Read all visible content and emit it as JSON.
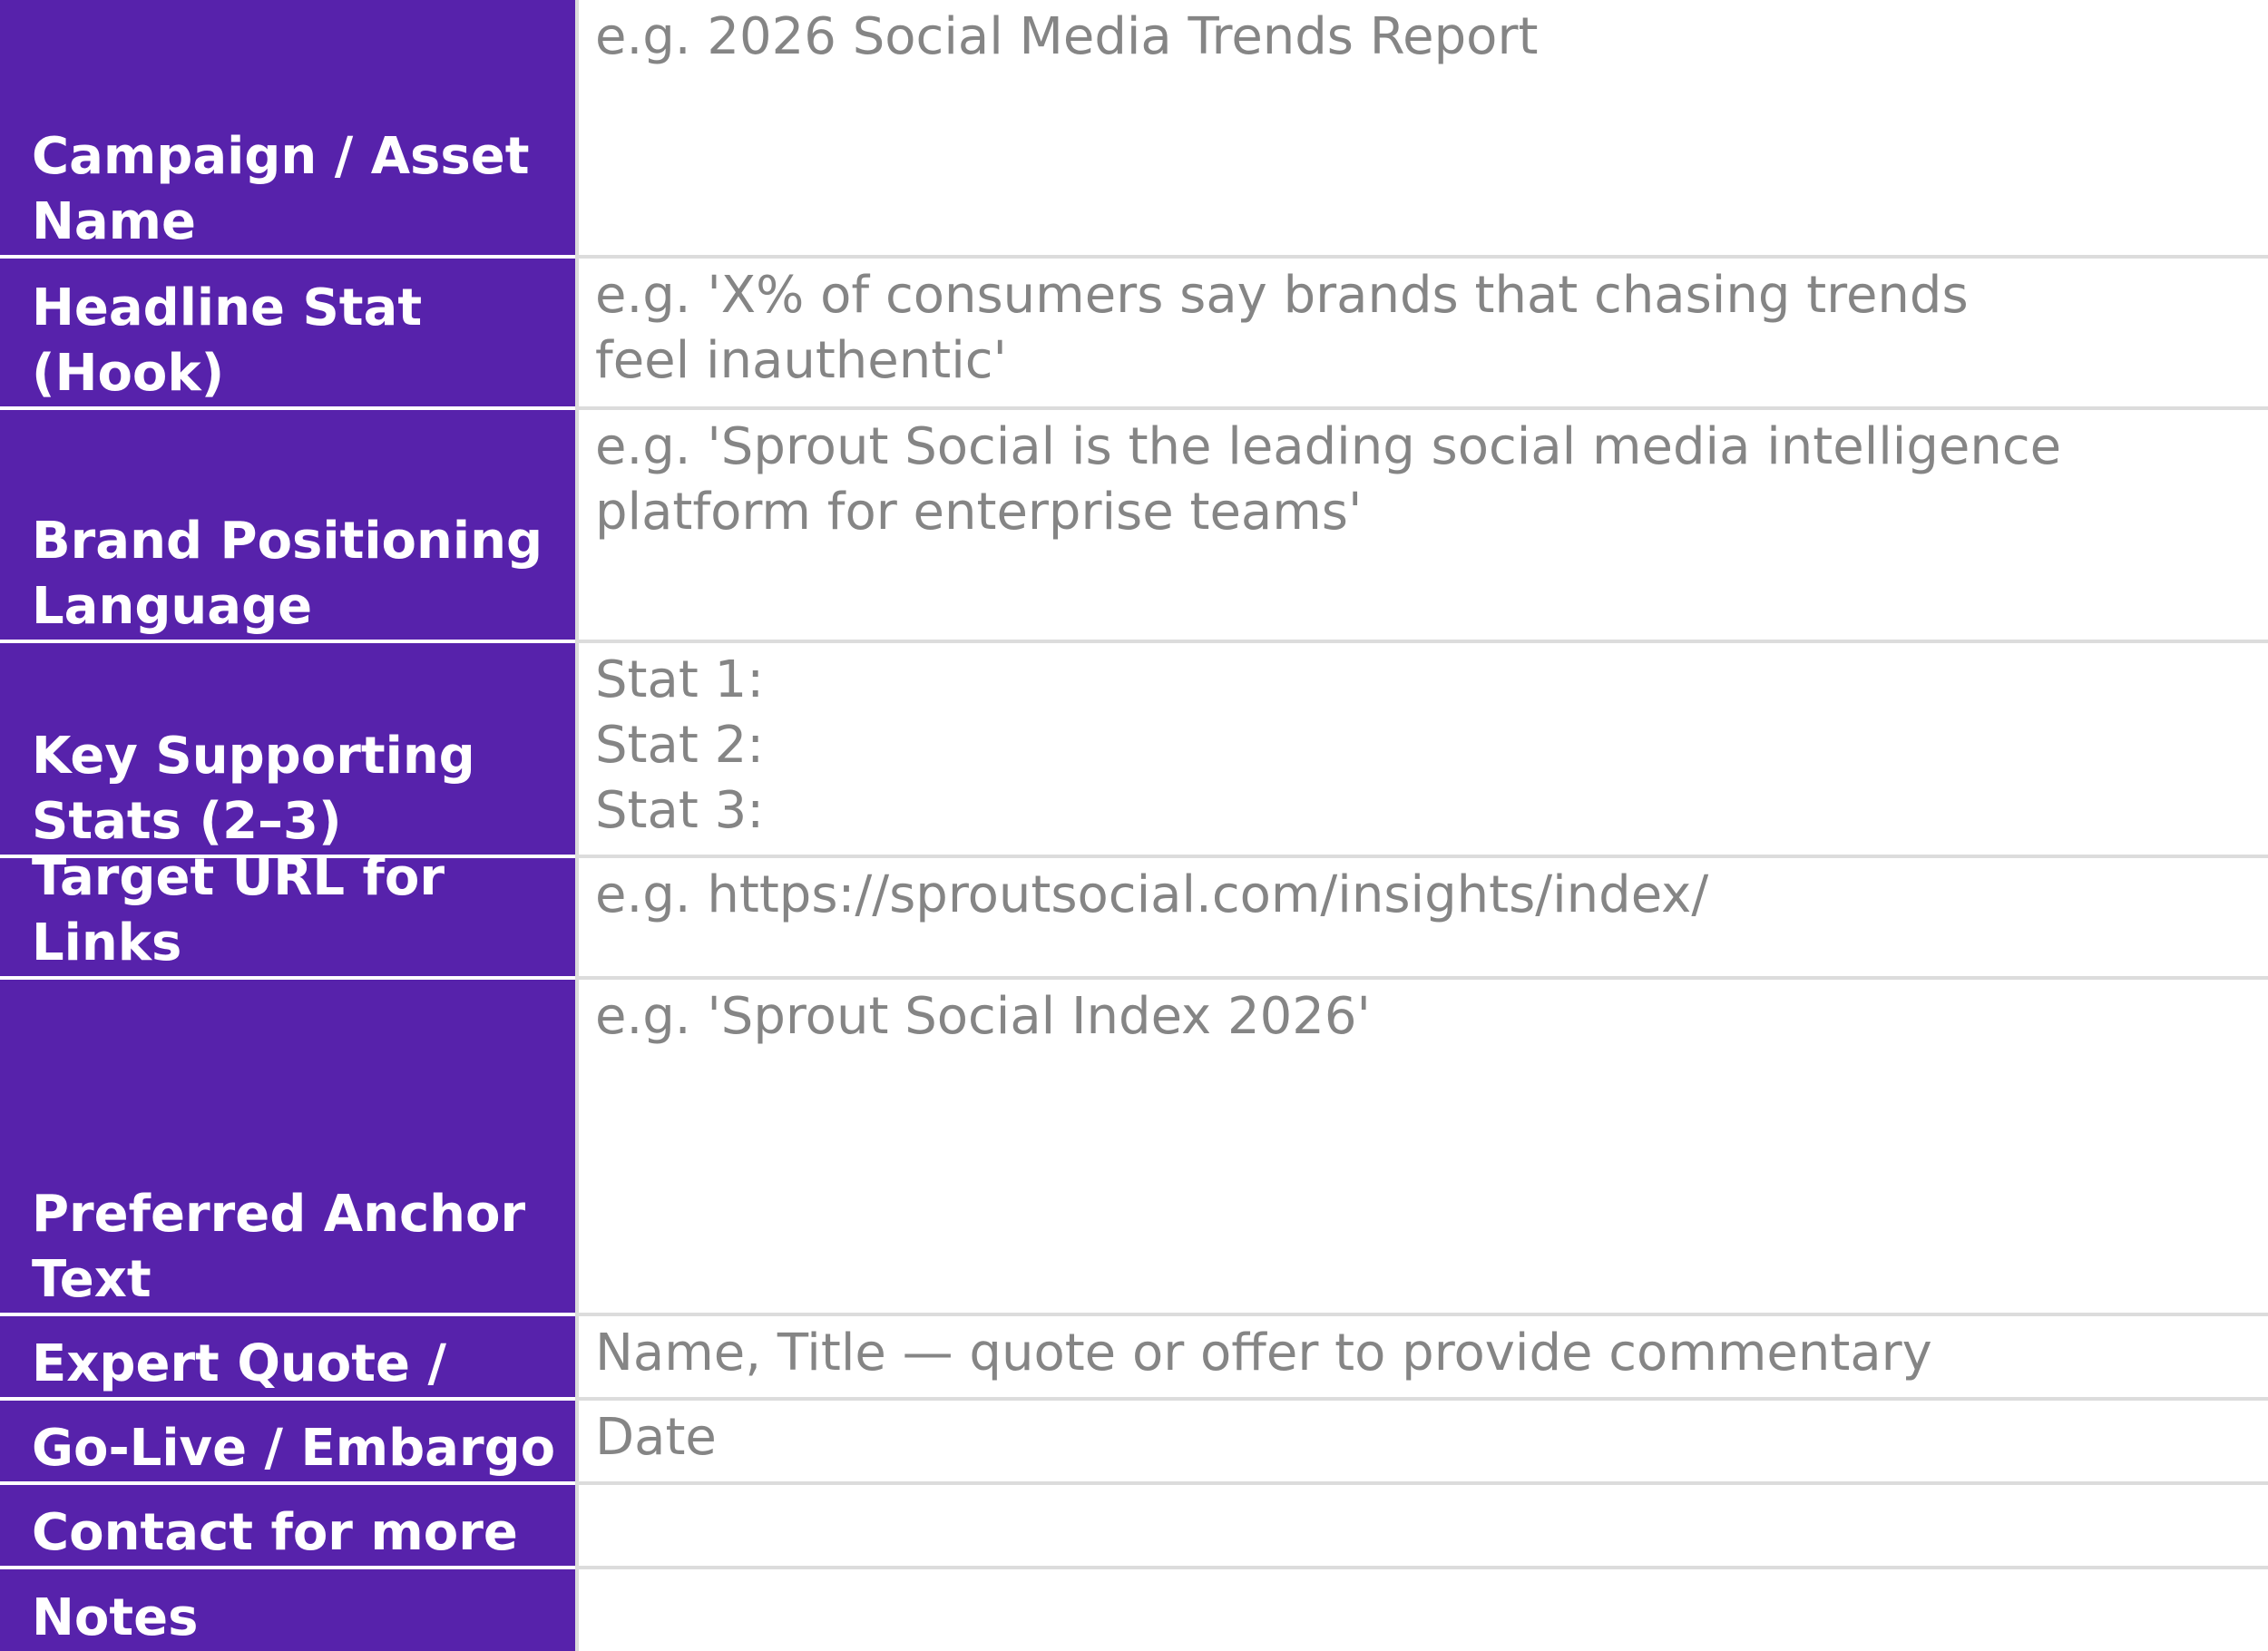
{
  "brief": {
    "colors": {
      "label_background": "#5722ab",
      "label_text": "#ffffff",
      "value_text": "#858585",
      "divider": "#dcdcdc"
    },
    "rows": [
      {
        "label": "Campaign / Asset\nName",
        "value": "e.g. 2026 Social Media Trends Report"
      },
      {
        "label": "Headline Stat\n(Hook)",
        "value": "e.g. 'X% of consumers say brands that chasing trends\nfeel inauthentic'"
      },
      {
        "label": "Brand Positioning\nLanguage",
        "value": "e.g. 'Sprout Social is the leading social media intelligence\nplatform for enterprise teams'"
      },
      {
        "label": "Key Supporting\nStats (2–3)",
        "value": "Stat 1:\nStat 2:\nStat 3:"
      },
      {
        "label": "Target URL for Links",
        "value": "e.g. https://sproutsocial.com/insights/index/"
      },
      {
        "label": "Preferred Anchor\nText",
        "value": "e.g. 'Sprout Social Index 2026'"
      },
      {
        "label": "Expert Quote /",
        "value": "Name, Title — quote or offer to provide commentary"
      },
      {
        "label": "Go-Live / Embargo",
        "value": "Date"
      },
      {
        "label": "Contact for more",
        "value": ""
      },
      {
        "label": "Notes",
        "value": ""
      }
    ]
  }
}
